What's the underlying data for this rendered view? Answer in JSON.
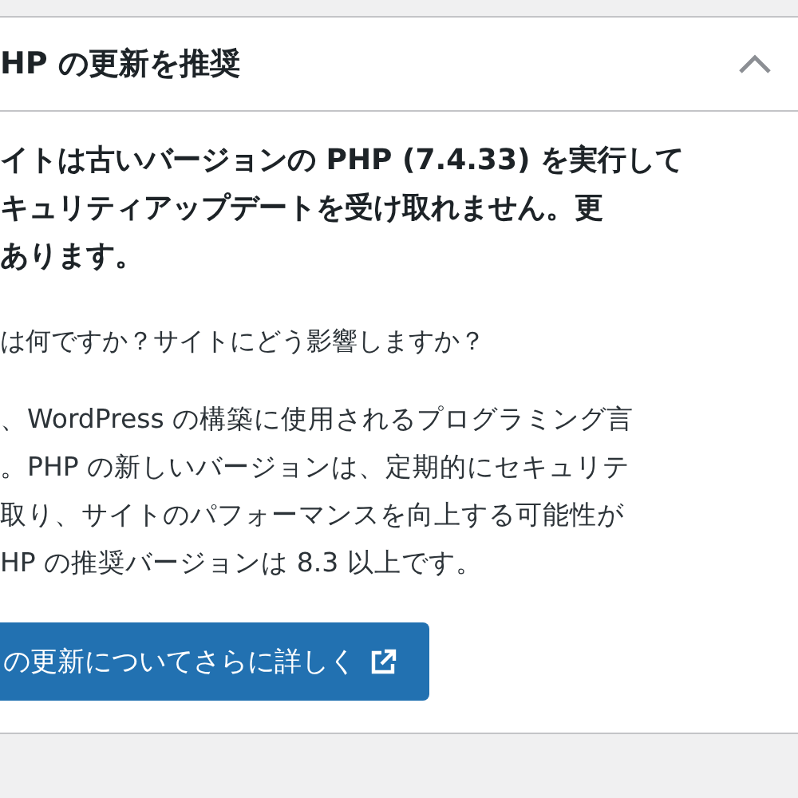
{
  "widget": {
    "title": "HP の更新を推奨",
    "expanded": true
  },
  "warning_lines": [
    "イトは古いバージョンの PHP (7.4.33) を実行して",
    "キュリティアップデートを受け取れません。更",
    "あります。"
  ],
  "question": "は何ですか？サイトにどう影響しますか？",
  "explanation_lines": [
    "、WordPress の構築に使用されるプログラミング言",
    "。PHP の新しいバージョンは、定期的にセキュリテ",
    "取り、サイトのパフォーマンスを向上する可能性が",
    "HP の推奨バージョンは 8.3 以上です。"
  ],
  "button": {
    "label": "の更新についてさらに詳しく"
  }
}
